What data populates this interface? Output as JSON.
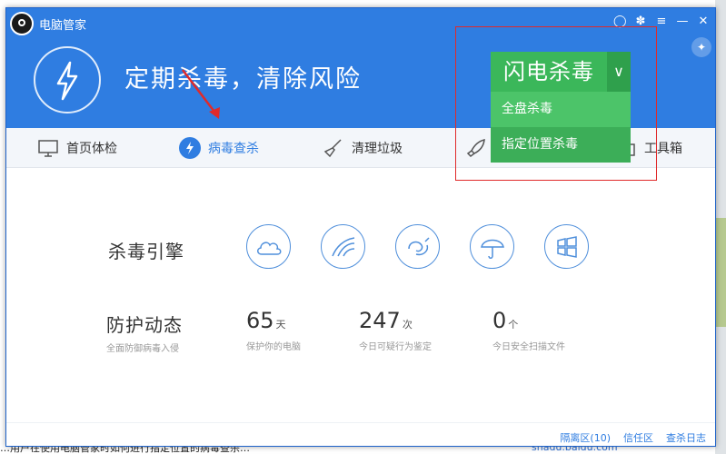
{
  "app": {
    "title": "电脑管家",
    "slogan": "定期杀毒，清除风险"
  },
  "scan": {
    "button_label": "闪电杀毒",
    "menu": [
      "全盘杀毒",
      "指定位置杀毒"
    ]
  },
  "tabs": [
    "首页体检",
    "病毒查杀",
    "清理垃圾",
    "工具箱"
  ],
  "engine": {
    "label": "杀毒引擎"
  },
  "protection": {
    "label": "防护动态",
    "subtitle": "全面防御病毒入侵",
    "stats": [
      {
        "value": "65",
        "unit": "天",
        "caption": "保护你的电脑"
      },
      {
        "value": "247",
        "unit": "次",
        "caption": "今日可疑行为鉴定"
      },
      {
        "value": "0",
        "unit": "个",
        "caption": "今日安全扫描文件"
      }
    ]
  },
  "footer": {
    "links": [
      "隔离区(10)",
      "信任区",
      "查杀日志"
    ]
  },
  "background": {
    "url_text": "shadu.baidu.com",
    "bottom_text": "…用户在使用电脑管家时如何进行指定位置的病毒查杀…"
  },
  "colors": {
    "header": "#2f7de1",
    "scan_green": "#3bb75a",
    "annotation": "#e02a2a"
  }
}
